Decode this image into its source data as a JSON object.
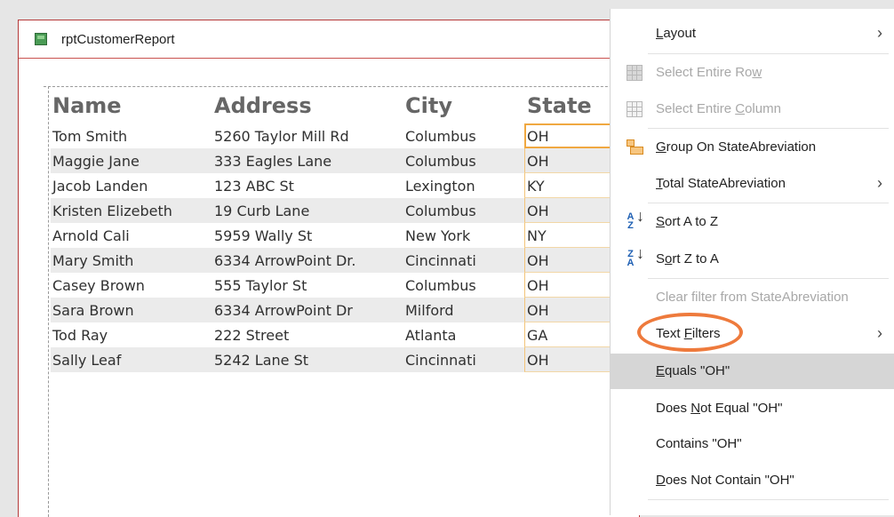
{
  "report": {
    "title": "rptCustomerReport",
    "columns": [
      "Name",
      "Address",
      "City",
      "State"
    ],
    "rows": [
      {
        "name": "Tom Smith",
        "address": "5260 Taylor Mill Rd",
        "city": "Columbus",
        "state": "OH"
      },
      {
        "name": "Maggie Jane",
        "address": "333 Eagles Lane",
        "city": "Columbus",
        "state": "OH"
      },
      {
        "name": "Jacob Landen",
        "address": "123 ABC St",
        "city": "Lexington",
        "state": "KY"
      },
      {
        "name": "Kristen Elizebeth",
        "address": "19 Curb Lane",
        "city": "Columbus",
        "state": "OH"
      },
      {
        "name": "Arnold Cali",
        "address": "5959 Wally St",
        "city": "New York",
        "state": "NY"
      },
      {
        "name": "Mary Smith",
        "address": "6334 ArrowPoint Dr.",
        "city": "Cincinnati",
        "state": "OH"
      },
      {
        "name": "Casey Brown",
        "address": "555 Taylor St",
        "city": "Columbus",
        "state": "OH"
      },
      {
        "name": "Sara Brown",
        "address": "6334 ArrowPoint Dr",
        "city": "Milford",
        "state": "OH"
      },
      {
        "name": "Tod Ray",
        "address": "222 Street",
        "city": "Atlanta",
        "state": "GA"
      },
      {
        "name": "Sally Leaf",
        "address": "5242 Lane St",
        "city": "Cincinnati",
        "state": "OH"
      }
    ]
  },
  "menu": {
    "layout": {
      "pre": "",
      "key": "L",
      "post": "ayout"
    },
    "select_row": {
      "pre": "Select Entire Ro",
      "key": "w",
      "post": ""
    },
    "select_column": {
      "pre": "Select Entire ",
      "key": "C",
      "post": "olumn"
    },
    "group_on": {
      "pre": "",
      "key": "G",
      "post": "roup On StateAbreviation"
    },
    "total": {
      "pre": "",
      "key": "T",
      "post": "otal StateAbreviation"
    },
    "sort_az": {
      "pre": "",
      "key": "S",
      "post": "ort A to Z"
    },
    "sort_za": {
      "pre": "S",
      "key": "o",
      "post": "rt Z to A"
    },
    "clear_filter": "Clear filter from StateAbreviation",
    "text_filters": {
      "pre": "Text ",
      "key": "F",
      "post": "ilters"
    },
    "equals": {
      "pre": "",
      "key": "E",
      "post": "quals \"OH\""
    },
    "not_equal": {
      "pre": "Does ",
      "key": "N",
      "post": "ot Equal \"OH\""
    },
    "contains": {
      "pre": "Contains \"OH\"",
      "key": "",
      "post": ""
    },
    "not_contain": {
      "pre": "",
      "key": "D",
      "post": "oes Not Contain \"OH\""
    }
  },
  "icons": {
    "report": "report-icon",
    "select_row": "table-row-icon",
    "select_column": "table-column-icon",
    "group": "group-icon",
    "sort_az": "sort-ascending-icon",
    "sort_za": "sort-descending-icon",
    "submenu": "chevron-right-icon"
  },
  "colors": {
    "highlight_oval": "#ee7a3c",
    "selected_cell_border": "#f0a841",
    "report_border": "#b53a3a"
  }
}
